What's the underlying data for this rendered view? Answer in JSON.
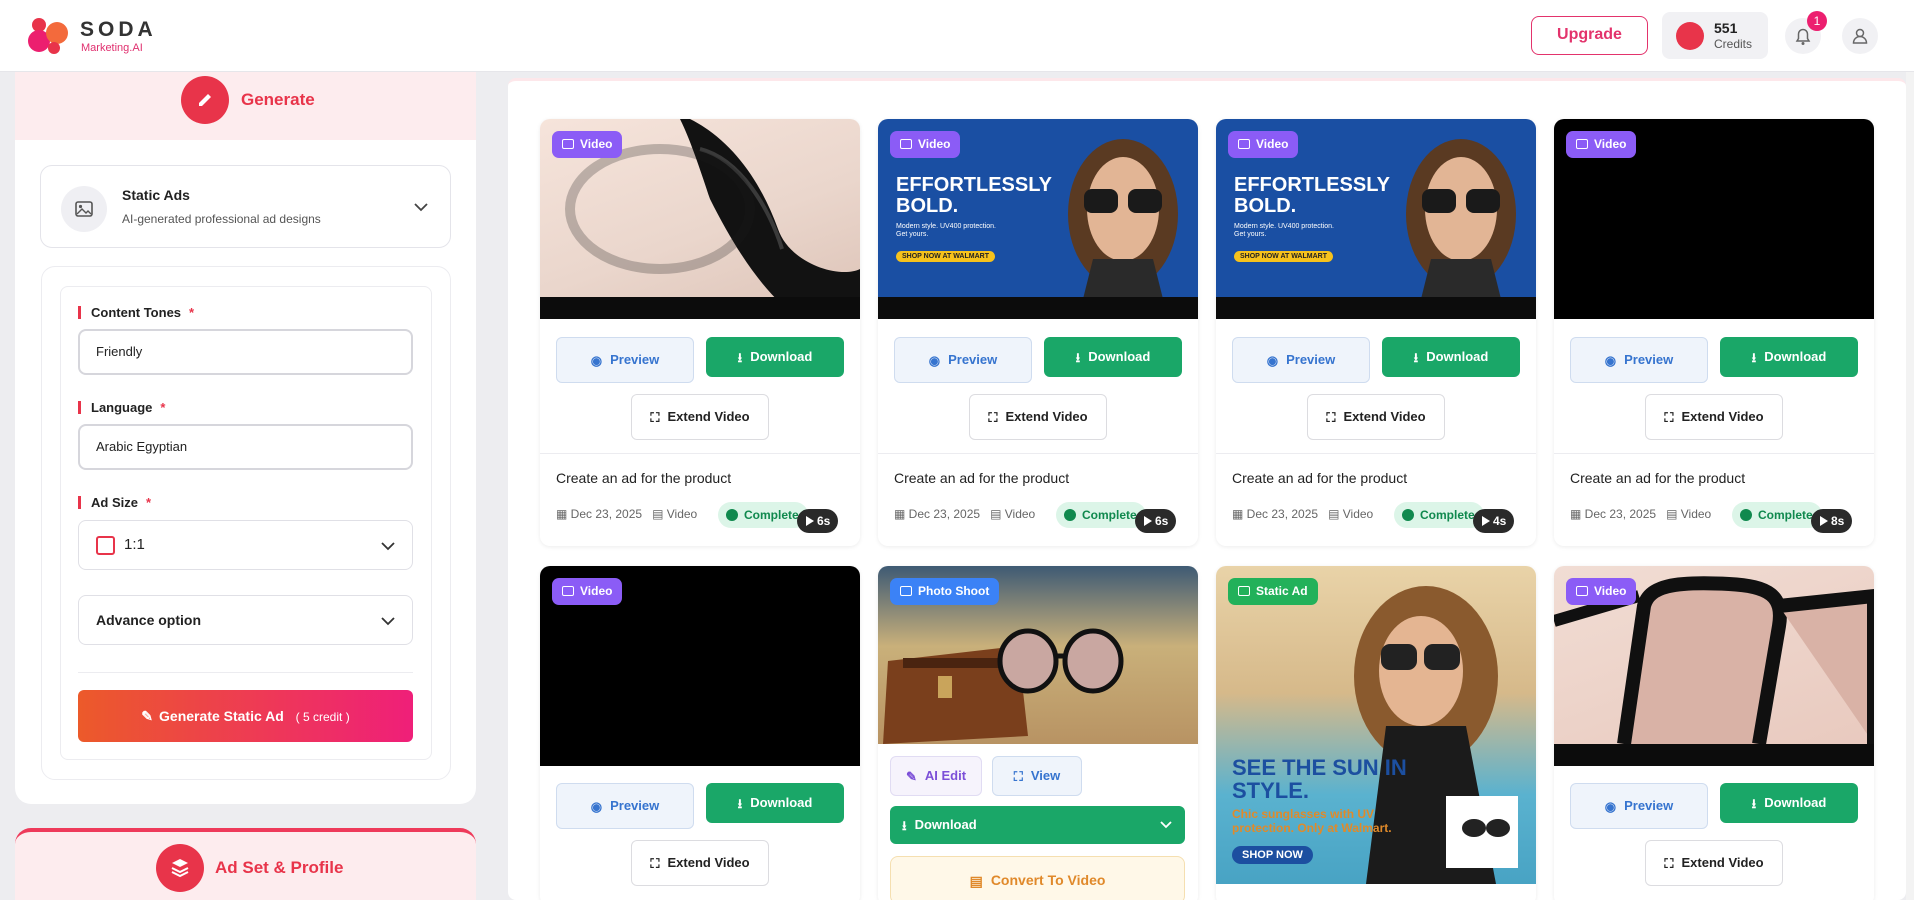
{
  "header": {
    "logo_word": "SODA",
    "logo_sub": "Marketing.AI",
    "upgrade_label": "Upgrade",
    "credits_value": "551",
    "credits_label": "Credits",
    "notification_count": "1"
  },
  "sidebar": {
    "generate_title": "Generate",
    "ad_type": {
      "title": "Static Ads",
      "subtitle": "AI-generated professional ad designs"
    },
    "form": {
      "tones_label": "Content Tones",
      "tones_value": "Friendly",
      "language_label": "Language",
      "language_value": "Arabic Egyptian",
      "size_label": "Ad Size",
      "size_value": "1:1",
      "advance_label": "Advance option",
      "required_mark": "*"
    },
    "generate_button": {
      "label": "Generate Static Ad",
      "cost": "( 5 credit )"
    },
    "adset_title": "Ad Set & Profile"
  },
  "cards": [
    {
      "tag": "Video",
      "preview": "Preview",
      "download": "Download",
      "extend": "Extend Video",
      "caption": "Create an ad for the product",
      "date": "Dec 23, 2025",
      "kind": "Video",
      "status": "Completed",
      "duration": "6s"
    },
    {
      "tag": "Video",
      "preview": "Preview",
      "download": "Download",
      "extend": "Extend Video",
      "caption": "Create an ad for the product",
      "date": "Dec 23, 2025",
      "kind": "Video",
      "status": "Completed",
      "duration": "6s",
      "ad_headline": "EFFORTLESSLY BOLD.",
      "ad_body": "Modern style. UV400 protection. Get yours.",
      "ad_cta": "SHOP NOW AT WALMART"
    },
    {
      "tag": "Video",
      "preview": "Preview",
      "download": "Download",
      "extend": "Extend Video",
      "caption": "Create an ad for the product",
      "date": "Dec 23, 2025",
      "kind": "Video",
      "status": "Completed",
      "duration": "4s",
      "ad_headline": "EFFORTLESSLY BOLD.",
      "ad_body": "Modern style. UV400 protection. Get yours.",
      "ad_cta": "SHOP NOW AT WALMART"
    },
    {
      "tag": "Video",
      "preview": "Preview",
      "download": "Download",
      "extend": "Extend Video",
      "caption": "Create an ad for the product",
      "date": "Dec 23, 2025",
      "kind": "Video",
      "status": "Completed",
      "duration": "8s"
    },
    {
      "tag": "Video",
      "preview": "Preview",
      "download": "Download",
      "extend": "Extend Video"
    },
    {
      "tag": "Photo Shoot",
      "ai_edit": "AI Edit",
      "view": "View",
      "download": "Download",
      "convert": "Convert To Video"
    },
    {
      "tag": "Static Ad",
      "ad_headline": "SEE THE SUN IN STYLE.",
      "ad_body": "Chic sunglasses with UV protection. Only at Walmart.",
      "ad_cta": "SHOP NOW"
    },
    {
      "tag": "Video",
      "preview": "Preview",
      "download": "Download",
      "extend": "Extend Video"
    }
  ],
  "colors": {
    "brand": "#e8344a",
    "download_green": "#1aa768",
    "video_tag": "#8b5cf6",
    "photo_tag": "#3b82f6",
    "static_tag": "#22b15a"
  }
}
